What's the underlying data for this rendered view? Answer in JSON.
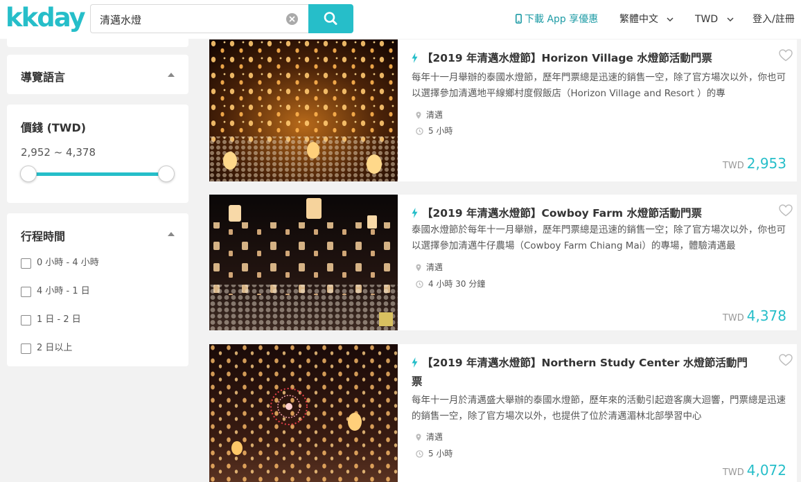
{
  "header": {
    "logo": "kkday",
    "search_value": "清邁水燈",
    "nav": {
      "app": "下載 App 享優惠",
      "language": "繁體中文",
      "currency": "TWD",
      "login": "登入/註冊"
    }
  },
  "sidebar": {
    "guide_language": {
      "title": "導覽語言"
    },
    "price": {
      "title": "價錢 (TWD)",
      "range": "2,952 ~ 4,378"
    },
    "duration": {
      "title": "行程時間",
      "options": [
        "0 小時 - 4 小時",
        "4 小時 - 1 日",
        "1 日 - 2 日",
        "2 日以上"
      ]
    }
  },
  "results": [
    {
      "title": "【2019 年清邁水燈節】Horizon Village 水燈節活動門票",
      "description": "每年十一月舉辦的泰國水燈節，歷年門票總是迅速的銷售一空，除了官方場次以外，你也可以選擇參加清邁地平線鄉村度假飯店（Horizon Village and Resort ）的專",
      "location": "清邁",
      "duration": "5 小時",
      "currency": "TWD",
      "price": "2,953"
    },
    {
      "title": "【2019 年清邁水燈節】Cowboy Farm 水燈節活動門票",
      "description": "泰國水燈節於每年十一月舉辦，歷年門票總是迅速的銷售一空；除了官方場次以外，你也可以選擇參加清邁牛仔農場（Cowboy Farm Chiang Mai）的專場，體驗清邁最",
      "location": "清邁",
      "duration": "4 小時 30 分鐘",
      "currency": "TWD",
      "price": "4,378"
    },
    {
      "title": "【2019 年清邁水燈節】Northern Study Center 水燈節活動門票",
      "description": "每年十一月於清邁盛大舉辦的泰國水燈節，歷年來的活動引起遊客廣大迴響，門票總是迅速的銷售一空，除了官方場次以外，也提供了位於清邁湄林北部學習中心",
      "location": "清邁",
      "duration": "5 小時",
      "currency": "TWD",
      "price": "4,072"
    }
  ],
  "icons": {
    "accent": "#26bec9",
    "lightning": "lightning-icon",
    "heart": "heart-icon",
    "location": "location-pin-icon",
    "clock": "clock-icon"
  }
}
